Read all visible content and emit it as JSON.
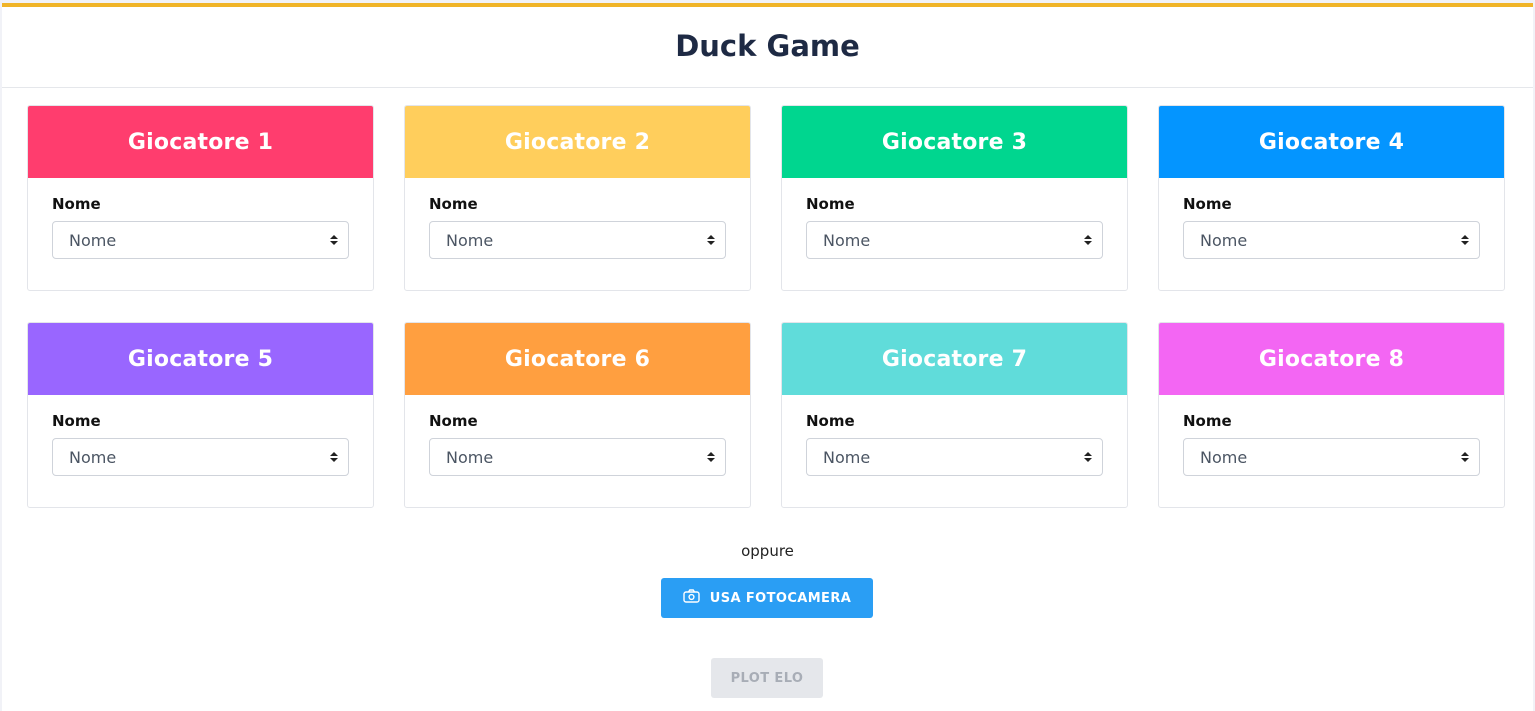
{
  "header": {
    "title": "Duck Game"
  },
  "players": [
    {
      "title": "Giocatore 1",
      "color": "#ff3d6e",
      "label": "Nome",
      "selected": "Nome"
    },
    {
      "title": "Giocatore 2",
      "color": "#ffce5c",
      "label": "Nome",
      "selected": "Nome"
    },
    {
      "title": "Giocatore 3",
      "color": "#00d68f",
      "label": "Nome",
      "selected": "Nome"
    },
    {
      "title": "Giocatore 4",
      "color": "#0495ff",
      "label": "Nome",
      "selected": "Nome"
    },
    {
      "title": "Giocatore 5",
      "color": "#9966ff",
      "label": "Nome",
      "selected": "Nome"
    },
    {
      "title": "Giocatore 6",
      "color": "#ff9f40",
      "label": "Nome",
      "selected": "Nome"
    },
    {
      "title": "Giocatore 7",
      "color": "#60dcda",
      "label": "Nome",
      "selected": "Nome"
    },
    {
      "title": "Giocatore 8",
      "color": "#f366f3",
      "label": "Nome",
      "selected": "Nome"
    }
  ],
  "alternative_text": "oppure",
  "camera_button": {
    "label": "USA FOTOCAMERA",
    "icon": "camera-icon",
    "color": "#2a9ef4"
  },
  "plot_button": {
    "label": "PLOT ELO",
    "disabled": true
  },
  "accent_color": "#f0b428"
}
